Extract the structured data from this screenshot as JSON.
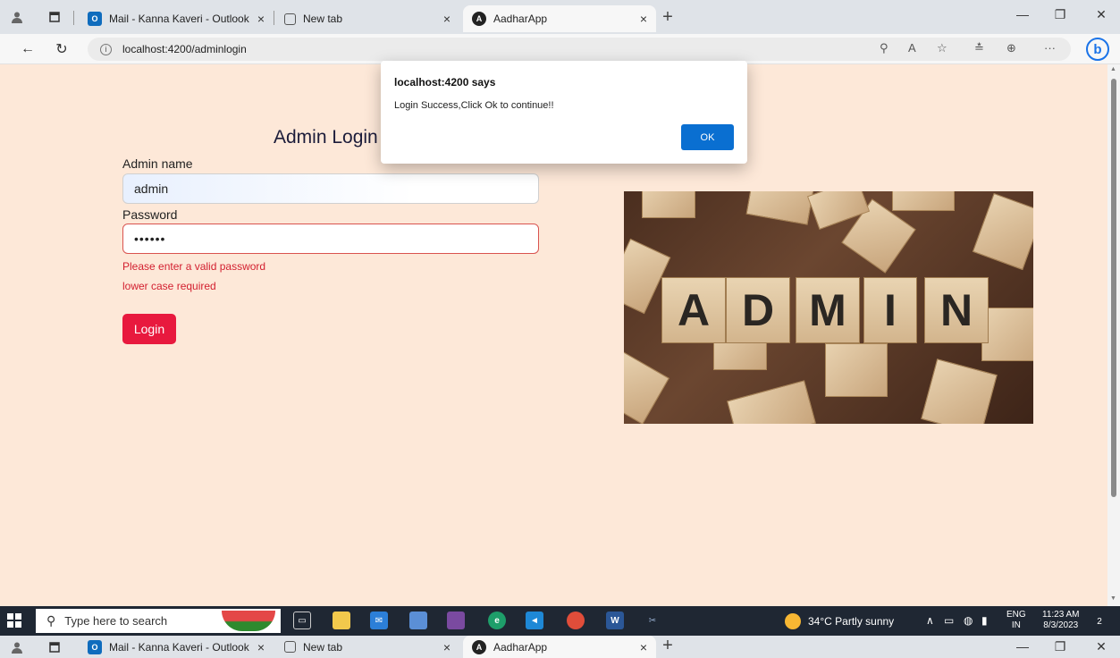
{
  "browser": {
    "tabs": [
      {
        "label": "Mail - Kanna Kaveri - Outlook",
        "icon": "outlook-icon"
      },
      {
        "label": "New tab",
        "icon": "newtab-icon"
      },
      {
        "label": "AadharApp",
        "icon": "angular-icon",
        "active": true
      }
    ],
    "close_glyph": "×",
    "new_tab_glyph": "+",
    "url": "localhost:4200/adminlogin"
  },
  "page": {
    "title": "Admin Login",
    "admin_name_label": "Admin name",
    "admin_name_value": "admin",
    "password_label": "Password",
    "password_value": "••••••",
    "errors": [
      "Please enter a valid password",
      "lower case required"
    ],
    "login_button": "Login",
    "image_letters": [
      "A",
      "D",
      "M",
      "I",
      "N"
    ]
  },
  "dialog": {
    "title": "localhost:4200 says",
    "message": "Login Success,Click Ok to continue!!",
    "ok_label": "OK"
  },
  "taskbar": {
    "search_placeholder": "Type here to search",
    "weather": "34°C  Partly sunny",
    "lang_top": "ENG",
    "lang_bottom": "IN",
    "time": "11:23 AM",
    "date": "8/3/2023",
    "notification_count": "2"
  },
  "colors": {
    "page_bg": "#fde8d8",
    "login_button": "#e8193e",
    "error_text": "#d32030",
    "dialog_ok": "#0a6fd1"
  }
}
